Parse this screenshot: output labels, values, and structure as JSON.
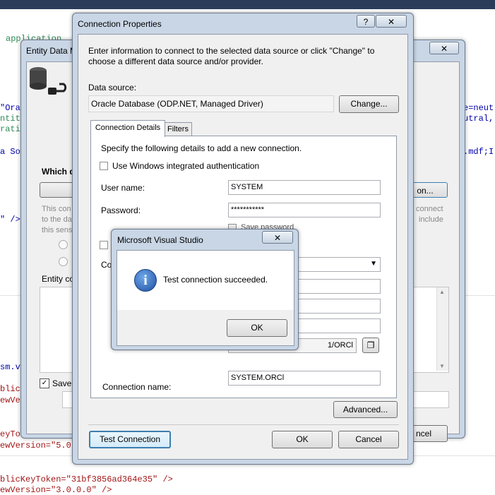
{
  "editor": {
    "lines": [
      {
        "text": "application",
        "color": "#2e8b57"
      },
      {
        "text": "\"Ora",
        "color": "#0000aa"
      },
      {
        "text": "ntit",
        "color": "#2e8b57"
      },
      {
        "text": "rati",
        "color": "#2e8b57"
      },
      {
        "text": "a So",
        "color": "#0000aa"
      },
      {
        "text": "\" />",
        "color": "#0000aa"
      },
      {
        "text": "sm.v",
        "color": "#0000aa"
      },
      {
        "text": "blicK",
        "color": "#a31515"
      },
      {
        "text": "ewVe",
        "color": "#a31515"
      },
      {
        "text": "eyTok",
        "color": "#a31515"
      },
      {
        "text": "ewVersion=\"5.0.",
        "color": "#a31515"
      },
      {
        "text": "blicKeyToken=\"31bf3856ad364e35\" />",
        "color": "#a31515"
      },
      {
        "text": "ewVersion=\"3.0.0.0\" />",
        "color": "#a31515"
      }
    ],
    "right_lines": [
      {
        "text": "e=neut",
        "color": "#0000aa"
      },
      {
        "text": "utral,",
        "color": "#0000aa"
      },
      {
        "text": ".mdf;I",
        "color": "#0000aa"
      }
    ]
  },
  "entity_wizard": {
    "title": "Entity Data M",
    "close_glyph": "✕",
    "heading": "Which d",
    "body_lines": [
      "This con",
      "to the da",
      "this sens"
    ],
    "right_lines": [
      "connect",
      "include"
    ],
    "button_right": "on...",
    "entity_conn_label": "Entity co",
    "save_label": "Save",
    "cancel_label": "ncel"
  },
  "conn_dialog": {
    "title": "Connection Properties",
    "help_glyph": "?",
    "close_glyph": "✕",
    "intro": "Enter information to connect to the selected data source or click \"Change\" to choose a different data source and/or provider.",
    "data_source_label": "Data source:",
    "data_source_value": "Oracle Database (ODP.NET, Managed Driver)",
    "change_button": "Change...",
    "tabs": [
      {
        "label": "Connection Details",
        "active": true
      },
      {
        "label": "Filters",
        "active": false
      }
    ],
    "specify_text": "Specify the following details to add a new connection.",
    "windows_auth_label": "Use Windows integrated authentication",
    "windows_auth_checked": false,
    "username_label": "User name:",
    "username_value": "SYSTEM",
    "password_label": "Password:",
    "password_value": "***********",
    "save_password_label": "Save password",
    "datasource_partial_label": "Co",
    "path_partial_value": "1/ORCl",
    "connection_name_label": "Connection name:",
    "connection_name_value": "SYSTEM.ORCl",
    "advanced_button": "Advanced...",
    "test_button": "Test Connection",
    "ok_button": "OK",
    "cancel_button": "Cancel"
  },
  "msgbox": {
    "title": "Microsoft Visual Studio",
    "close_glyph": "✕",
    "message": "Test connection succeeded.",
    "icon": "info-icon",
    "icon_glyph": "i",
    "ok_button": "OK"
  }
}
